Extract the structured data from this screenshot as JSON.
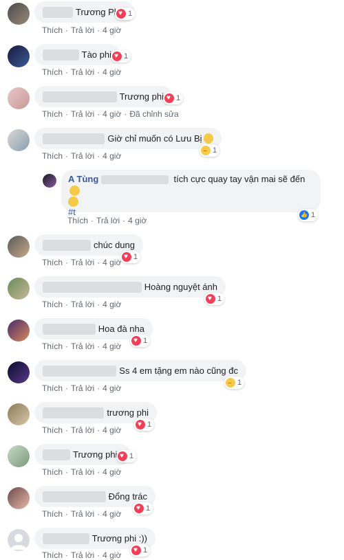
{
  "actions": {
    "like": "Thích",
    "reply": "Trả lời",
    "time": "4 giờ",
    "edited": "Đã chỉnh sửa",
    "sep": "·"
  },
  "comments": [
    {
      "text": "Trương Phi",
      "count": "1",
      "reaction": "heart"
    },
    {
      "text": "Tào phi",
      "count": "1",
      "reaction": "heart"
    },
    {
      "text": "Trương phi",
      "count": "1",
      "reaction": "heart"
    },
    {
      "text": "Giờ chỉ muốn có Lưu Bị",
      "count": "1",
      "reaction": "haha"
    },
    {
      "text": "chúc dung",
      "count": "1",
      "reaction": "heart"
    },
    {
      "text": "Hoàng nguyệt ánh",
      "count": "1",
      "reaction": "heart"
    },
    {
      "text": "Hoa đà nha",
      "count": "1",
      "reaction": "heart"
    },
    {
      "text": "Ss 4 em tặng em nào cũng đc",
      "count": "1",
      "reaction": "haha"
    },
    {
      "text": "trương phi",
      "count": "1",
      "reaction": "heart"
    },
    {
      "text": "Trương phi",
      "count": "1",
      "reaction": "heart"
    },
    {
      "text": "Đổng trác",
      "count": "1",
      "reaction": "heart"
    },
    {
      "text": "Trương phi :))",
      "count": "1",
      "reaction": "heart"
    }
  ],
  "reply": {
    "name": "A Tùng",
    "text": "tích cực quay tay vận mai sẽ đến",
    "tag": "#t",
    "count": "1",
    "reaction": "like"
  },
  "colors": {
    "bubble": "#f2f3f5",
    "name": "#385898",
    "meta": "#606770",
    "heart": "#f33e58",
    "like": "#1877f2"
  }
}
